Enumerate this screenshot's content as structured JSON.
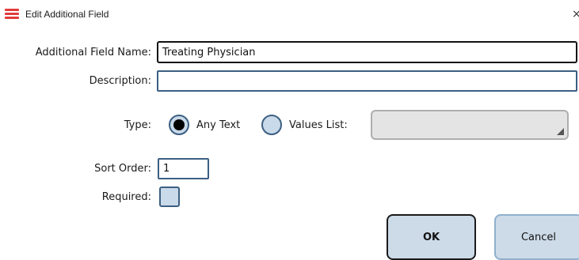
{
  "window": {
    "title": "Edit Additional Field",
    "close_glyph": "×",
    "icon": "stacked-lines-icon",
    "accent": "#e23b3b"
  },
  "form": {
    "name_label": "Additional Field Name:",
    "name_value": "Treating Physician",
    "description_label": "Description:",
    "description_value": "",
    "type_label": "Type:",
    "type_options": [
      "Any Text",
      "Values List:"
    ],
    "type_selected": "Any Text",
    "values_list_value": "",
    "sort_order_label": "Sort Order:",
    "sort_order_value": "1",
    "required_label": "Required:",
    "required_checked": false
  },
  "buttons": {
    "ok_label": "OK",
    "cancel_label": "Cancel"
  },
  "colors": {
    "control_fill": "#c9daea",
    "control_border": "#3c5f82",
    "button_fill": "#cddbe8"
  }
}
